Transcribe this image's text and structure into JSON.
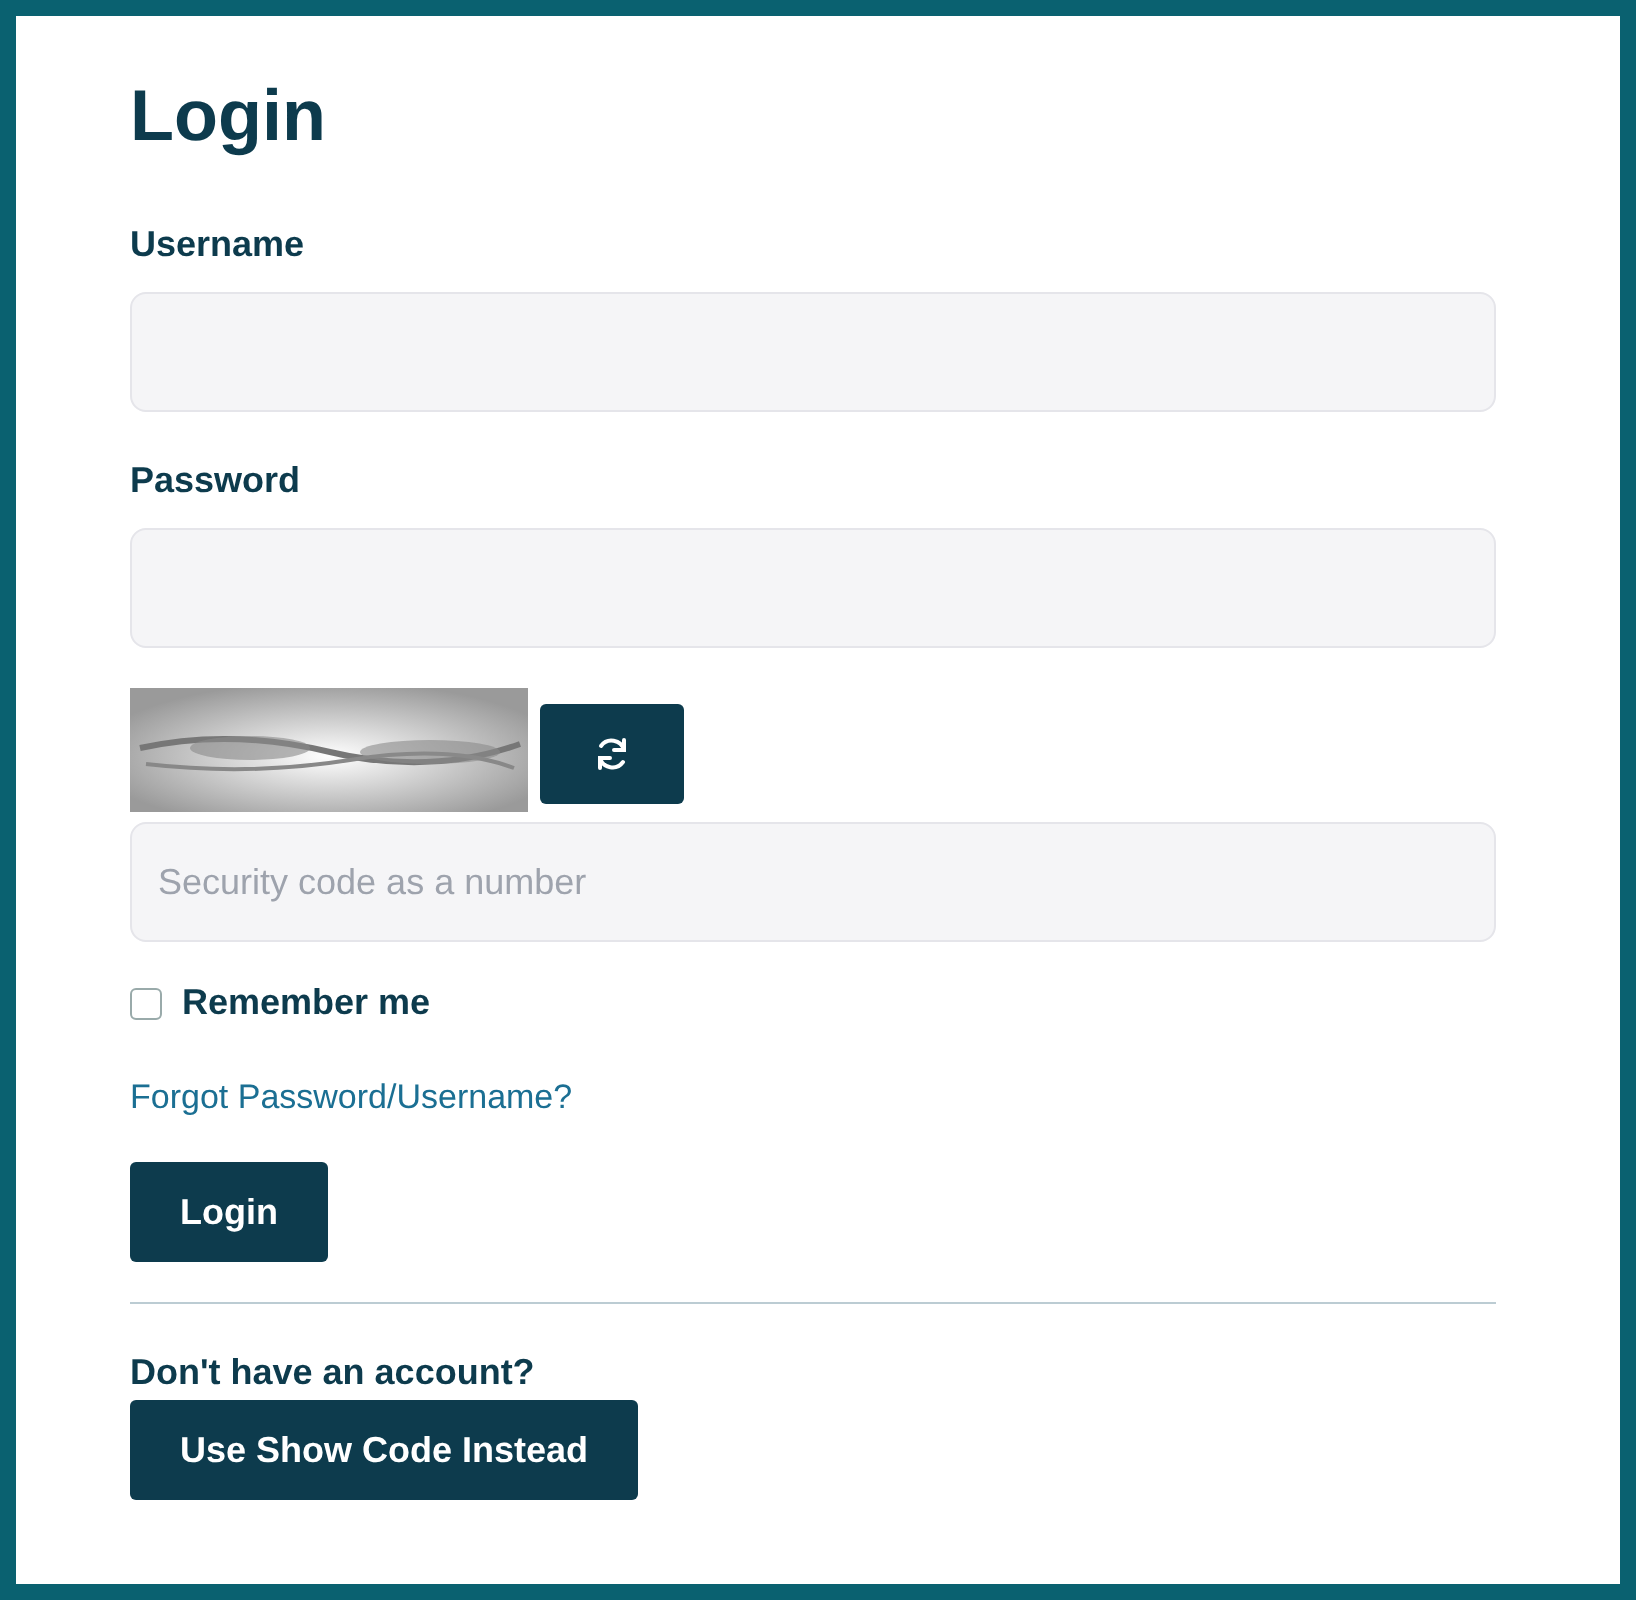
{
  "title": "Login",
  "fields": [
    {
      "label": "Username"
    },
    {
      "label": "Password"
    }
  ],
  "security_field": {
    "placeholder": "Security code as a number"
  },
  "remember": {
    "label": "Remember me",
    "checked": false
  },
  "forgot_link": "Forgot Password/Username?",
  "login_button": "Login",
  "signup": {
    "prompt": "Don't have an account?",
    "button": "Use Show Code Instead"
  }
}
